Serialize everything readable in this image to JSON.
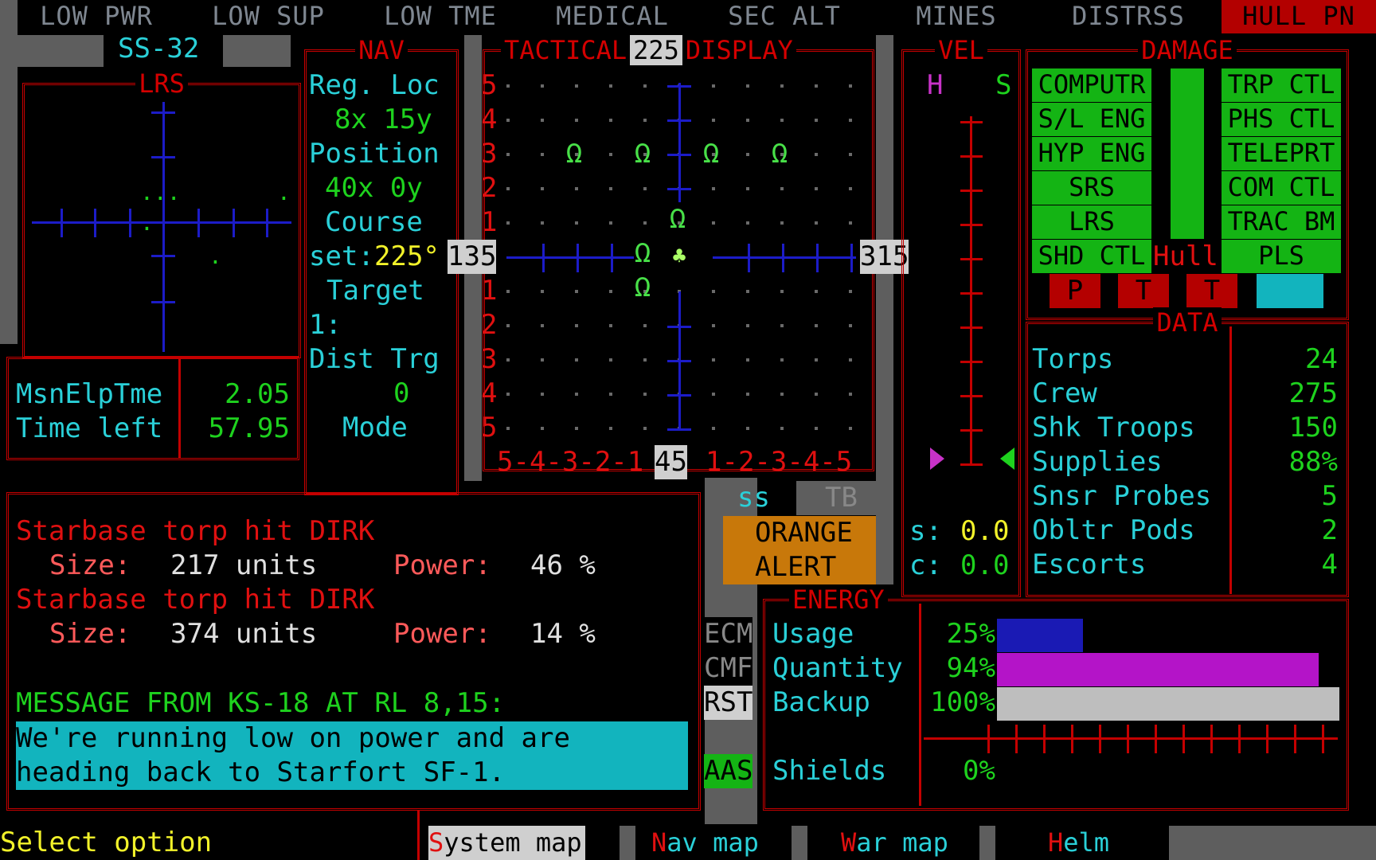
{
  "top_tabs": [
    {
      "label": "LOW PWR",
      "alert": false
    },
    {
      "label": "LOW SUP",
      "alert": false
    },
    {
      "label": "LOW TME",
      "alert": false
    },
    {
      "label": "MEDICAL",
      "alert": false
    },
    {
      "label": "SEC ALT",
      "alert": false
    },
    {
      "label": "MINES",
      "alert": false
    },
    {
      "label": "DISTRSS",
      "alert": false
    },
    {
      "label": "HULL PN",
      "alert": true
    }
  ],
  "ship_id": "SS-32",
  "lrs": {
    "title": "LRS"
  },
  "mission": {
    "elapsed_label": "MsnElpTme",
    "elapsed_value": "2.05",
    "left_label": "Time left",
    "left_value": "57.95"
  },
  "nav": {
    "title": "NAV",
    "reg_loc_label": "Reg. Loc",
    "reg_loc_value": "8x 15y",
    "position_label": "Position",
    "position_value": "40x  0y",
    "course_label": "Course",
    "set_label": "set:",
    "set_value": "225°",
    "target_label": "Target",
    "target_value": "1:",
    "dist_label": "Dist Trg",
    "dist_value": "0",
    "mode_label": "Mode"
  },
  "tactical": {
    "title_left": "TACTICAL",
    "title_right": "DISPLAY",
    "heading_top": "225",
    "heading_left": "135",
    "heading_right": "315",
    "heading_bottom": "45",
    "row_labels": [
      "5",
      "4",
      "3",
      "2",
      "1",
      "1",
      "2",
      "3",
      "4",
      "5"
    ],
    "col_labels_left": "5-4-3-2-1",
    "col_labels_right": "1-2-3-4-5",
    "ship_glyph": "Ω",
    "player_glyph": "♣"
  },
  "modes": {
    "ss": "ss",
    "tb": "TB"
  },
  "alert": {
    "line1": "ORANGE",
    "line2": "ALERT",
    "color": "#c8780a"
  },
  "vel": {
    "title": "VEL",
    "h": "H",
    "s": "S",
    "s_label": "s:",
    "s_value": "0.0",
    "c_label": "c:",
    "c_value": "0.0"
  },
  "damage": {
    "title": "DAMAGE",
    "left": [
      "COMPUTR",
      "S/L ENG",
      "HYP ENG",
      "SRS",
      "LRS",
      "SHD CTL"
    ],
    "right": [
      "TRP CTL",
      "PHS CTL",
      "TELEPRT",
      "COM CTL",
      "TRAC BM",
      "PLS"
    ],
    "hull": "Hull",
    "indicators": [
      "P",
      "T",
      "T"
    ]
  },
  "data": {
    "title": "DATA",
    "rows": [
      {
        "label": "Torps",
        "value": "24"
      },
      {
        "label": "Crew",
        "value": "275"
      },
      {
        "label": "Shk Troops",
        "value": "150"
      },
      {
        "label": "Supplies",
        "value": "88%"
      },
      {
        "label": "Snsr Probes",
        "value": "5"
      },
      {
        "label": "Obltr Pods",
        "value": "2"
      },
      {
        "label": "Escorts",
        "value": "4"
      }
    ]
  },
  "messages": {
    "lines": [
      {
        "text": "Starbase torp hit DIRK"
      },
      {
        "size_label": "Size:",
        "size_value": "217 units",
        "power_label": "Power:",
        "power_value": "46 %"
      },
      {
        "text": "Starbase torp hit DIRK"
      },
      {
        "size_label": "Size:",
        "size_value": "374 units",
        "power_label": "Power:",
        "power_value": "14 %"
      }
    ],
    "header": "MESSAGE FROM KS-18 AT RL  8,15:",
    "body_line1": "We're running low on power and are",
    "body_line2": "heading back to Starfort SF-1."
  },
  "side_buttons": {
    "ecm": "ECM",
    "cmf": "CMF",
    "rst": "RST",
    "aas": "AAS"
  },
  "energy": {
    "title": "ENERGY",
    "usage_label": "Usage",
    "usage_value": "25%",
    "usage_fraction": 0.25,
    "usage_color": "#1a1ab4",
    "quantity_label": "Quantity",
    "quantity_value": "94%",
    "quantity_fraction": 0.94,
    "quantity_color": "#b414c8",
    "backup_label": "Backup",
    "backup_value": "100%",
    "backup_fraction": 1.0,
    "backup_color": "#bebebe",
    "shields_label": "Shields",
    "shields_value": "0%"
  },
  "status": {
    "prompt": "Select option"
  },
  "bottom_menu": [
    {
      "hot": "S",
      "rest": "ystem map",
      "active": true
    },
    {
      "hot": "N",
      "rest": "av map",
      "active": false
    },
    {
      "hot": "W",
      "rest": "ar map",
      "active": false
    },
    {
      "hot": "H",
      "rest": "elm",
      "active": false
    }
  ]
}
